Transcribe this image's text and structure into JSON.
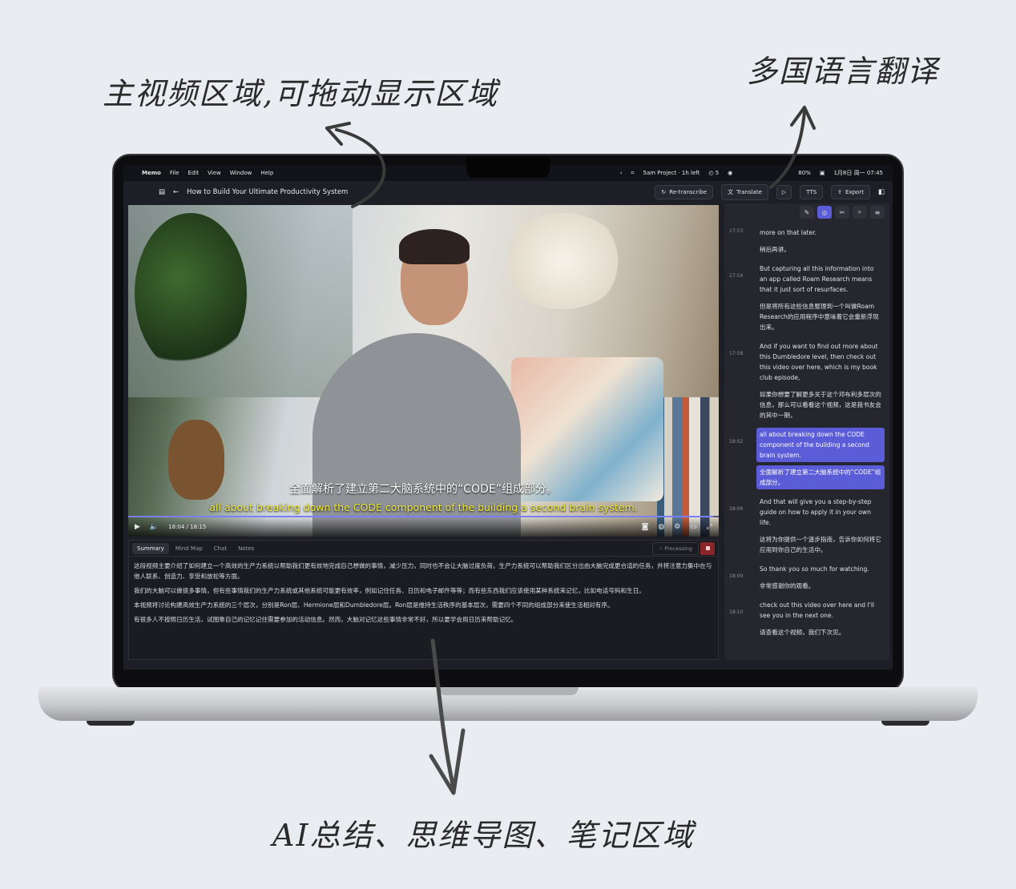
{
  "annotations": {
    "main_area": "主视频区域,可拖动显示区域",
    "translate": "多国语言翻译",
    "ai_area": "AI总结、思维导图、笔记区域"
  },
  "menubar": {
    "apple": "",
    "app": "Memo",
    "items": [
      "File",
      "Edit",
      "View",
      "Window",
      "Help"
    ],
    "project": "5am Project · 1h left",
    "tasks": "5",
    "battery": "80%",
    "datetime": "1月8日 周一  07:45"
  },
  "toolbar": {
    "title": "How to Build Your Ultimate Productivity System",
    "retranscribe": "Re-transcribe",
    "translate": "Translate",
    "tts": "TTS",
    "export": "Export"
  },
  "video": {
    "subtitle_cn": "全面解析了建立第二大脑系统中的“CODE”组成部分。",
    "subtitle_en": "all about breaking down the CODE component of the building a second brain system.",
    "time": "18:04 / 18:15",
    "progress": 0.99
  },
  "panel": {
    "tabs": [
      "Summary",
      "Mind Map",
      "Chat",
      "Notes"
    ],
    "processing": "Processing",
    "summary": [
      "这段视频主要介绍了如何建立一个高效的生产力系统以帮助我们更有效地完成自己想做的事情，减少压力，同时也不会让大脑过度负荷。生产力系统可以帮助我们区分出由大脑完成更合适的任务，并将注意力集中在与他人联系、创造力、享受和放松等方面。",
      "我们的大脑可以做很多事情，但有些事情我们的生产力系统或其他系统可能更有效率，例如记住任务、日历和电子邮件等等；而有些东西我们应该使用某种系统来记忆，比如电话号码和生日。",
      "本视频将讨论构建高效生产力系统的三个层次，分别是Ron层、Hermione层和Dumbledore层。Ron层是维持生活秩序的基本层次，需要四个不同的组成部分来使生活相对有序。",
      "有很多人不按照日历生活，试图靠自己的记忆记住需要参加的活动信息。然而，大脑对记忆这些事情非常不好，所以要学会用日历来帮助记忆。"
    ]
  },
  "transcript": [
    {
      "time": "17:53",
      "lines": [
        "more on that later.",
        "稍后再讲。"
      ],
      "hl": false
    },
    {
      "time": "17:54",
      "lines": [
        "But capturing all this information into an app called Roam Research means that it just sort of resurfaces.",
        "但是将所有这些信息整理到一个叫做Roam Research的应用程序中意味着它会重新浮现出来。"
      ],
      "hl": false
    },
    {
      "time": "17:58",
      "lines": [
        "And if you want to find out more about this Dumbledore level, then check out this video over here, which is my book club episode,",
        "如果你想要了解更多关于这个邓布利多层次的信息，那么可以看看这个视频，这是我书友会的其中一期，"
      ],
      "hl": false
    },
    {
      "time": "18:02",
      "lines": [
        "all about breaking down the CODE component of the building a second brain system.",
        "全面解析了建立第二大脑系统中的“CODE”组成部分。"
      ],
      "hl": true
    },
    {
      "time": "18:06",
      "lines": [
        "And that will give you a step-by-step guide on how to apply it in your own life.",
        "这将为你提供一个逐步指南，告诉你如何将它应用到你自己的生活中。"
      ],
      "hl": false
    },
    {
      "time": "18:09",
      "lines": [
        "So thank you so much for watching.",
        "非常感谢你的观看。"
      ],
      "hl": false
    },
    {
      "time": "18:10",
      "lines": [
        "check out this video over here and I'll see you in the next one.",
        "请查看这个视频，我们下次见。"
      ],
      "hl": false
    }
  ],
  "colors": {
    "accent": "#5b5dd8",
    "subtitle_en": "#f0eb3c",
    "stop": "#8a2529"
  }
}
